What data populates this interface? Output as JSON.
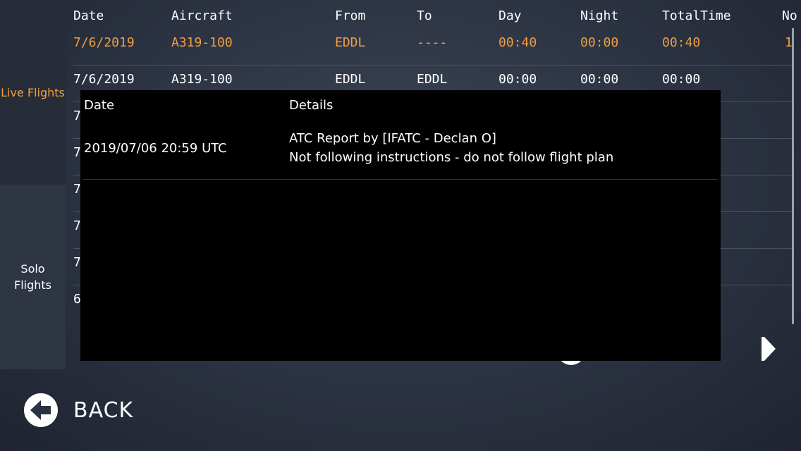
{
  "sidebar": {
    "live_label": "Live Flights",
    "solo_label": "Solo Flights"
  },
  "table": {
    "headers": [
      "Date",
      "Aircraft",
      "From",
      "To",
      "Day",
      "Night",
      "TotalTime",
      "No"
    ],
    "rows": [
      {
        "date": "7/6/2019",
        "aircraft": "A319-100",
        "from": "EDDL",
        "to": "----",
        "day": "00:40",
        "night": "00:00",
        "total": "00:40",
        "no": "1"
      },
      {
        "date": "7/6/2019",
        "aircraft": "A319-100",
        "from": "EDDL",
        "to": "EDDL",
        "day": "00:00",
        "night": "00:00",
        "total": "00:00",
        "no": ""
      }
    ],
    "partial_rows": [
      "7",
      "7",
      "7",
      "7",
      "7",
      "6"
    ]
  },
  "modal": {
    "header_date": "Date",
    "header_details": "Details",
    "entry": {
      "date": "2019/07/06 20:59 UTC",
      "details_line1": "ATC Report by [IFATC - Declan O]",
      "details_line2": "Not following instructions - do not follow flight plan"
    }
  },
  "footer": {
    "back_label": "BACK"
  },
  "colors": {
    "accent": "#f0a040",
    "background": "#2b3241",
    "modal_bg": "#000000"
  },
  "icons": {
    "back": "arrow-left-circle-icon",
    "next": "triangle-right-icon"
  }
}
